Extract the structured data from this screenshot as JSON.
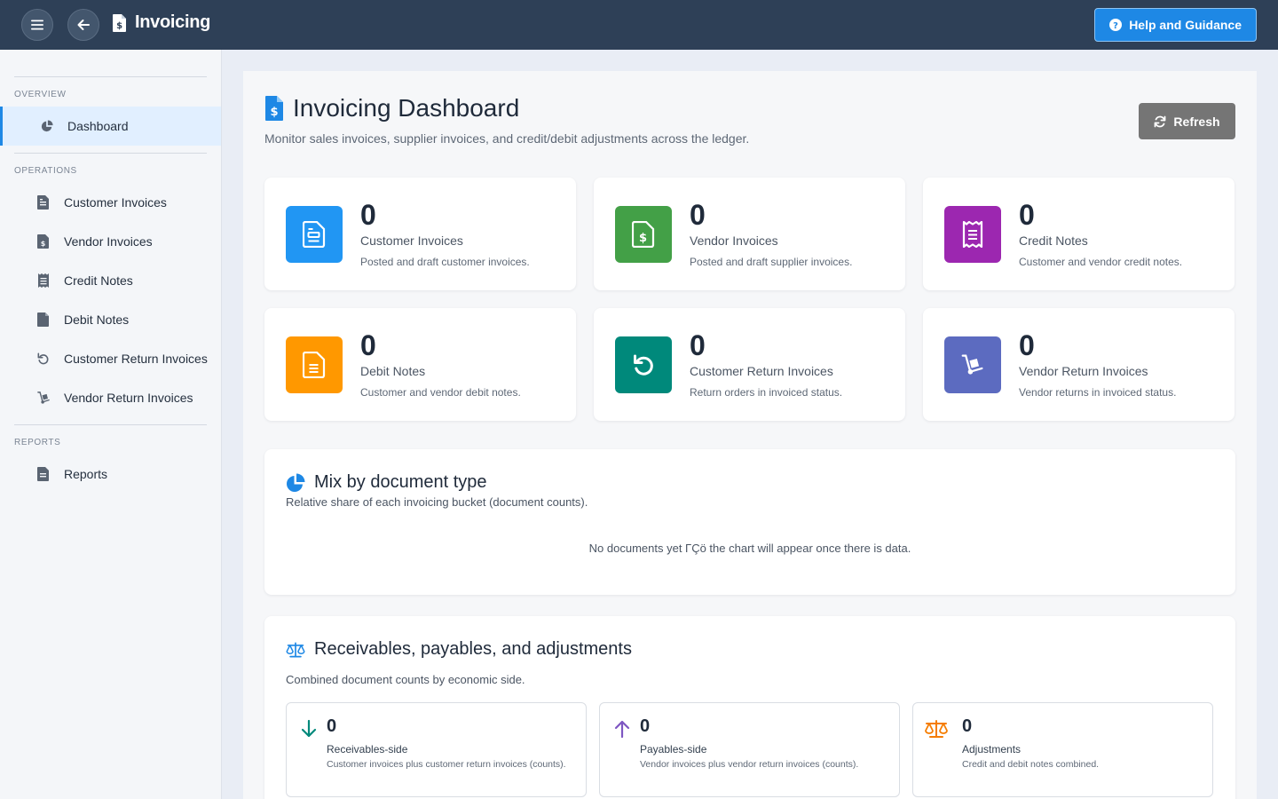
{
  "topbar": {
    "app_title": "Invoicing",
    "help_label": "Help and Guidance",
    "menu_icon": "hamburger-icon",
    "back_icon": "arrow-left-icon"
  },
  "sidebar": {
    "sections": [
      {
        "heading": "OVERVIEW",
        "items": [
          {
            "label": "Dashboard",
            "icon": "pie-chart-icon",
            "active": true
          }
        ]
      },
      {
        "heading": "OPERATIONS",
        "items": [
          {
            "label": "Customer Invoices",
            "icon": "invoice-icon"
          },
          {
            "label": "Vendor Invoices",
            "icon": "dollar-invoice-icon"
          },
          {
            "label": "Credit Notes",
            "icon": "receipt-icon"
          },
          {
            "label": "Debit Notes",
            "icon": "document-icon"
          },
          {
            "label": "Customer Return Invoices",
            "icon": "undo-icon"
          },
          {
            "label": "Vendor Return Invoices",
            "icon": "dolly-icon"
          }
        ]
      },
      {
        "heading": "REPORTS",
        "items": [
          {
            "label": "Reports",
            "icon": "document-icon"
          }
        ]
      }
    ]
  },
  "page": {
    "title": "Invoicing Dashboard",
    "subtitle": "Monitor sales invoices, supplier invoices, and credit/debit adjustments across the ledger.",
    "refresh_label": "Refresh"
  },
  "stats": [
    {
      "value": "0",
      "label": "Customer Invoices",
      "desc": "Posted and draft customer invoices.",
      "color": "#2196f3",
      "icon": "invoice-icon"
    },
    {
      "value": "0",
      "label": "Vendor Invoices",
      "desc": "Posted and draft supplier invoices.",
      "color": "#43a047",
      "icon": "dollar-invoice-icon"
    },
    {
      "value": "0",
      "label": "Credit Notes",
      "desc": "Customer and vendor credit notes.",
      "color": "#9c27b0",
      "icon": "receipt-icon"
    },
    {
      "value": "0",
      "label": "Debit Notes",
      "desc": "Customer and vendor debit notes.",
      "color": "#ff9800",
      "icon": "document-icon"
    },
    {
      "value": "0",
      "label": "Customer Return Invoices",
      "desc": "Return orders in invoiced status.",
      "color": "#00897b",
      "icon": "undo-icon"
    },
    {
      "value": "0",
      "label": "Vendor Return Invoices",
      "desc": "Vendor returns in invoiced status.",
      "color": "#5c6bc0",
      "icon": "dolly-icon"
    }
  ],
  "mix": {
    "title": "Mix by document type",
    "subtitle": "Relative share of each invoicing bucket (document counts).",
    "empty_message": "No documents yet ΓÇö the chart will appear once there is data."
  },
  "rpa": {
    "title": "Receivables, payables, and adjustments",
    "subtitle": "Combined document counts by economic side.",
    "cards": [
      {
        "value": "0",
        "label": "Receivables-side",
        "desc": "Customer invoices plus customer return invoices (counts).",
        "icon": "arrow-down-icon",
        "color": "#00897b"
      },
      {
        "value": "0",
        "label": "Payables-side",
        "desc": "Vendor invoices plus vendor return invoices (counts).",
        "icon": "arrow-up-icon",
        "color": "#7e57c2"
      },
      {
        "value": "0",
        "label": "Adjustments",
        "desc": "Credit and debit notes combined.",
        "icon": "scale-icon",
        "color": "#f57c00"
      }
    ]
  },
  "colors": {
    "topbar": "#2e4057",
    "accent": "#1e88e5",
    "refresh": "#757575"
  }
}
